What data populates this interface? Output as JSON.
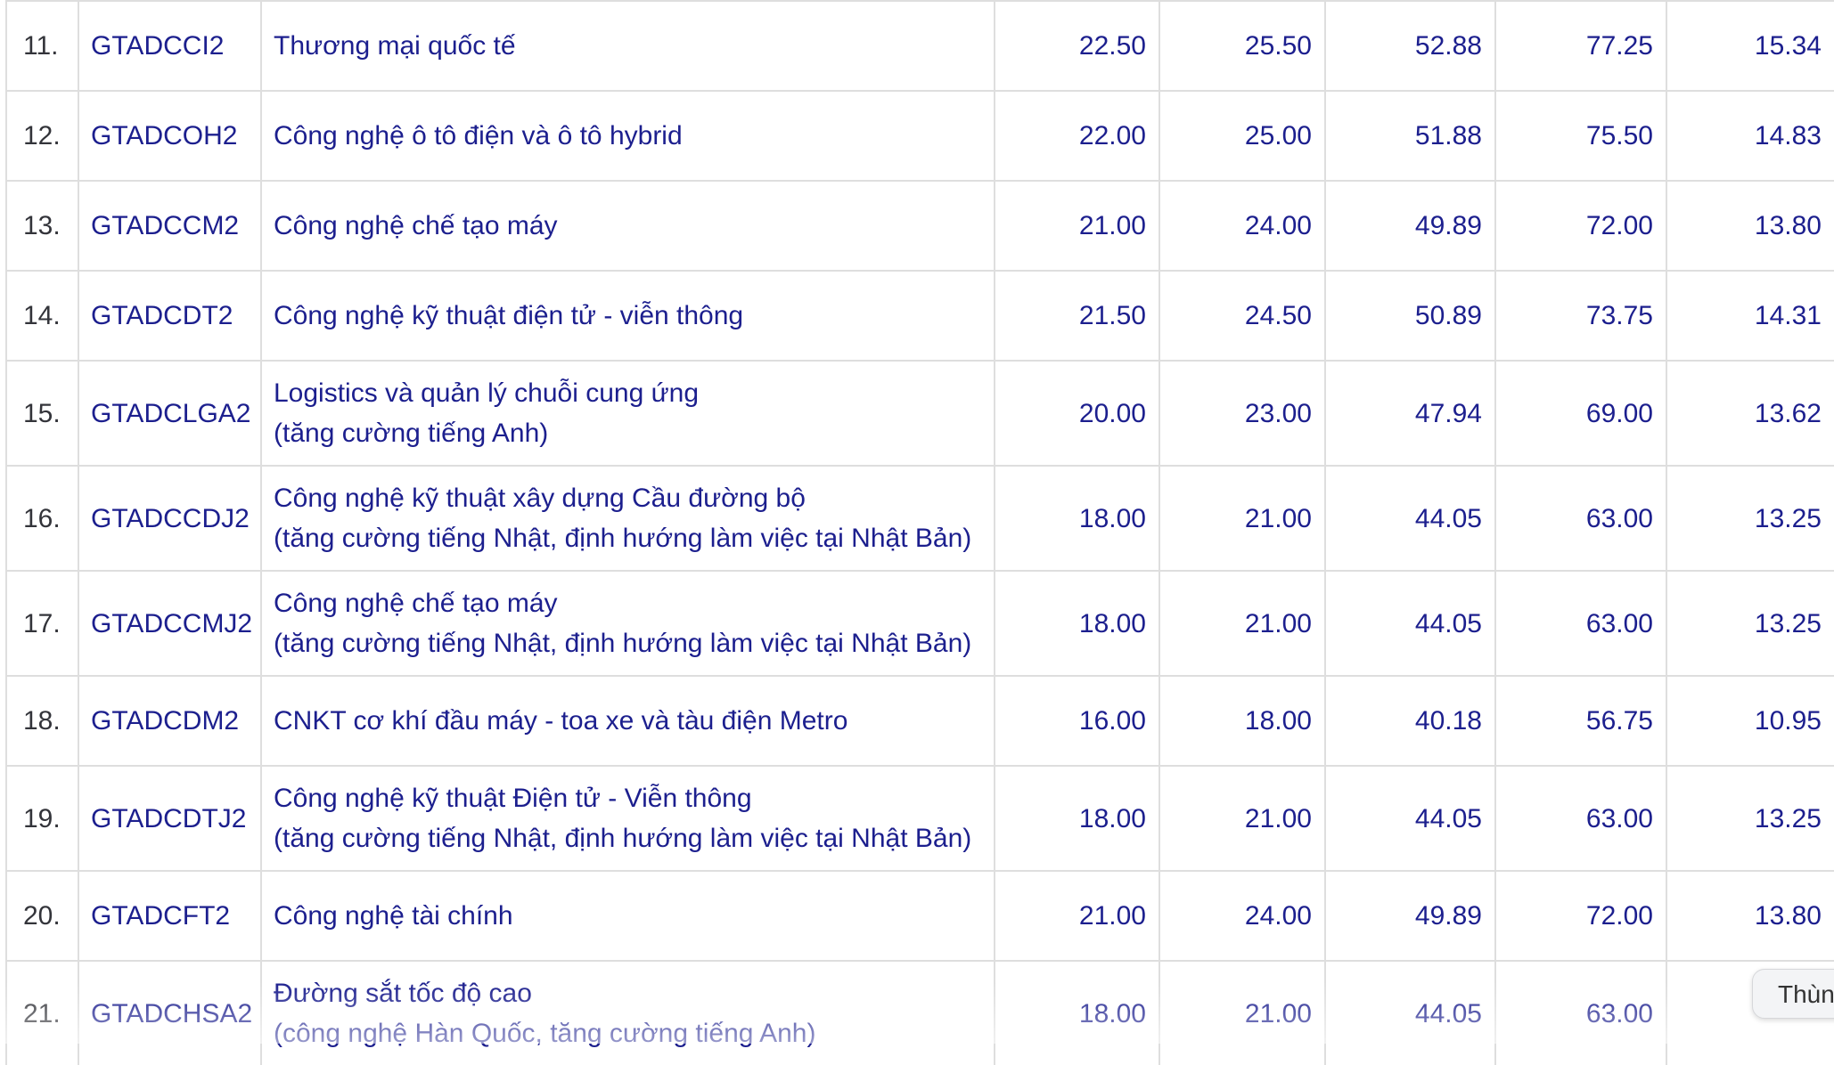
{
  "table": {
    "rows": [
      {
        "stt": "11.",
        "code": "GTADCCI2",
        "name": [
          "Thương mại quốc tế"
        ],
        "v1": "22.50",
        "v2": "25.50",
        "v3": "52.88",
        "v4": "77.25",
        "v5": "15.34"
      },
      {
        "stt": "12.",
        "code": "GTADCOH2",
        "name": [
          "Công nghệ ô tô điện và ô tô hybrid"
        ],
        "v1": "22.00",
        "v2": "25.00",
        "v3": "51.88",
        "v4": "75.50",
        "v5": "14.83"
      },
      {
        "stt": "13.",
        "code": "GTADCCM2",
        "name": [
          "Công nghệ chế tạo máy"
        ],
        "v1": "21.00",
        "v2": "24.00",
        "v3": "49.89",
        "v4": "72.00",
        "v5": "13.80"
      },
      {
        "stt": "14.",
        "code": "GTADCDT2",
        "name": [
          "Công nghệ kỹ thuật điện tử - viễn thông"
        ],
        "v1": "21.50",
        "v2": "24.50",
        "v3": "50.89",
        "v4": "73.75",
        "v5": "14.31"
      },
      {
        "stt": "15.",
        "code": "GTADCLGA2",
        "name": [
          "Logistics và quản lý chuỗi cung ứng",
          "(tăng cường tiếng Anh)"
        ],
        "v1": "20.00",
        "v2": "23.00",
        "v3": "47.94",
        "v4": "69.00",
        "v5": "13.62"
      },
      {
        "stt": "16.",
        "code": "GTADCCDJ2",
        "name": [
          "Công nghệ kỹ thuật xây dựng Cầu đường bộ",
          "(tăng cường tiếng Nhật, định hướng làm việc tại Nhật Bản)"
        ],
        "v1": "18.00",
        "v2": "21.00",
        "v3": "44.05",
        "v4": "63.00",
        "v5": "13.25"
      },
      {
        "stt": "17.",
        "code": "GTADCCMJ2",
        "name": [
          "Công nghệ chế tạo máy",
          "(tăng cường tiếng Nhật, định hướng làm việc tại Nhật Bản)"
        ],
        "v1": "18.00",
        "v2": "21.00",
        "v3": "44.05",
        "v4": "63.00",
        "v5": "13.25"
      },
      {
        "stt": "18.",
        "code": "GTADCDM2",
        "name": [
          "CNKT cơ khí đầu máy - toa xe và tàu điện Metro"
        ],
        "v1": "16.00",
        "v2": "18.00",
        "v3": "40.18",
        "v4": "56.75",
        "v5": "10.95"
      },
      {
        "stt": "19.",
        "code": "GTADCDTJ2",
        "name": [
          "Công nghệ kỹ thuật Điện tử - Viễn thông",
          "(tăng cường tiếng Nhật, định hướng làm việc tại Nhật Bản)"
        ],
        "v1": "18.00",
        "v2": "21.00",
        "v3": "44.05",
        "v4": "63.00",
        "v5": "13.25"
      },
      {
        "stt": "20.",
        "code": "GTADCFT2",
        "name": [
          "Công nghệ tài chính"
        ],
        "v1": "21.00",
        "v2": "24.00",
        "v3": "49.89",
        "v4": "72.00",
        "v5": "13.80"
      },
      {
        "stt": "21.",
        "code": "GTADCHSA2",
        "name": [
          "Đường sắt tốc độ cao",
          "(công nghệ Hàn Quốc, tăng cường tiếng Anh)"
        ],
        "v1": "18.00",
        "v2": "21.00",
        "v3": "44.05",
        "v4": "63.00",
        "v5": ""
      }
    ]
  },
  "floating_button": {
    "label": "Thùn"
  }
}
